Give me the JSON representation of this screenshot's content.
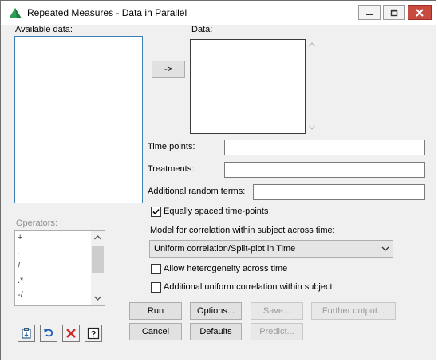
{
  "window": {
    "title": "Repeated Measures - Data in Parallel"
  },
  "labels": {
    "available_data": "Available data:",
    "data": "Data:",
    "time_points": "Time points:",
    "treatments": "Treatments:",
    "additional_random_terms": "Additional random terms:",
    "operators": "Operators:",
    "model_correlation": "Model for correlation within subject across time:"
  },
  "fields": {
    "time_points": "",
    "treatments": "",
    "additional_random_terms": ""
  },
  "move_button": {
    "label": "->"
  },
  "checkboxes": {
    "equally_spaced": {
      "label": "Equally spaced time-points",
      "checked": true
    },
    "heterogeneity": {
      "label": "Allow heterogeneity across time",
      "checked": false
    },
    "uniform_correlation": {
      "label": "Additional uniform correlation within subject",
      "checked": false
    }
  },
  "model_select": {
    "value": "Uniform correlation/Split-plot in Time"
  },
  "operators": [
    "+",
    ".",
    "/",
    ".*",
    "-/"
  ],
  "buttons": {
    "run": "Run",
    "options": "Options...",
    "save": "Save...",
    "further_output": "Further output...",
    "cancel": "Cancel",
    "defaults": "Defaults",
    "predict": "Predict..."
  },
  "toolbar_icons": [
    "clipboard-icon",
    "undo-icon",
    "clear-icon",
    "help-icon"
  ],
  "colors": {
    "close_button": "#c94b3f",
    "focus_border": "#0078d7",
    "app_icon": "#2e9e57"
  }
}
